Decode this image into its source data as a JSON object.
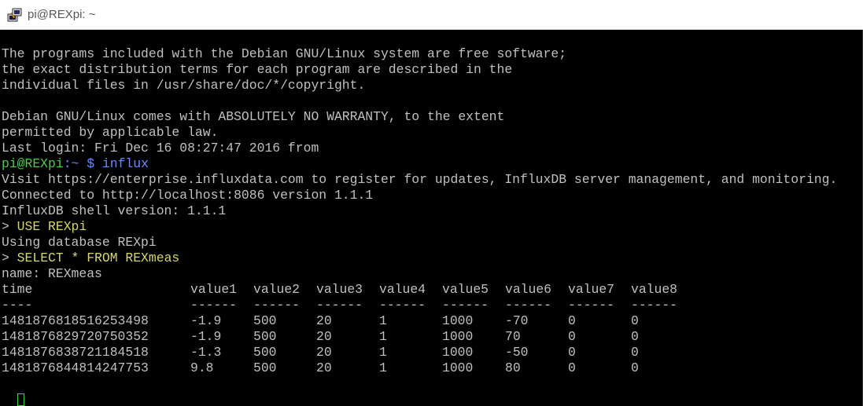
{
  "window": {
    "title": "pi@REXpi: ~",
    "icon": "putty-icon"
  },
  "colors": {
    "background": "#000000",
    "text": "#c0c0c0",
    "prompt_green": "#4ec94e",
    "prompt_blue": "#6a8cff",
    "command_yellow": "#d6d66b"
  },
  "terminal": {
    "motd": [
      "The programs included with the Debian GNU/Linux system are free software;",
      "the exact distribution terms for each program are described in the",
      "individual files in /usr/share/doc/*/copyright.",
      "",
      "Debian GNU/Linux comes with ABSOLUTELY NO WARRANTY, to the extent",
      "permitted by applicable law.",
      "Last login: Fri Dec 16 08:27:47 2016 from"
    ],
    "shell_prompt": {
      "user_host": "pi@REXpi",
      "path": ":~",
      "symbol": " $",
      "command": " influx"
    },
    "influx_output": [
      "Visit https://enterprise.influxdata.com to register for updates, InfluxDB server management, and monitoring.",
      "Connected to http://localhost:8086 version 1.1.1",
      "InfluxDB shell version: 1.1.1"
    ],
    "command1": {
      "prompt": ">",
      "text": " USE REXpi"
    },
    "response1": "Using database REXpi",
    "command2": {
      "prompt": ">",
      "text": " SELECT * FROM REXmeas"
    },
    "result_name": "name: REXmeas",
    "table": {
      "columns": [
        "time",
        "value1",
        "value2",
        "value3",
        "value4",
        "value5",
        "value6",
        "value7",
        "value8"
      ],
      "separator": [
        "----",
        "------",
        "------",
        "------",
        "------",
        "------",
        "------",
        "------",
        "------"
      ],
      "rows": [
        [
          "1481876818516253498",
          "-1.9",
          "500",
          "20",
          "1",
          "1000",
          "-70",
          "0",
          "0"
        ],
        [
          "1481876829720750352",
          "-1.9",
          "500",
          "20",
          "1",
          "1000",
          "70",
          "0",
          "0"
        ],
        [
          "1481876838721184518",
          "-1.3",
          "500",
          "20",
          "1",
          "1000",
          "-50",
          "0",
          "0"
        ],
        [
          "1481876844814247753",
          "9.8",
          "500",
          "20",
          "1",
          "1000",
          "80",
          "0",
          "0"
        ]
      ]
    },
    "final_prompt": ">"
  }
}
